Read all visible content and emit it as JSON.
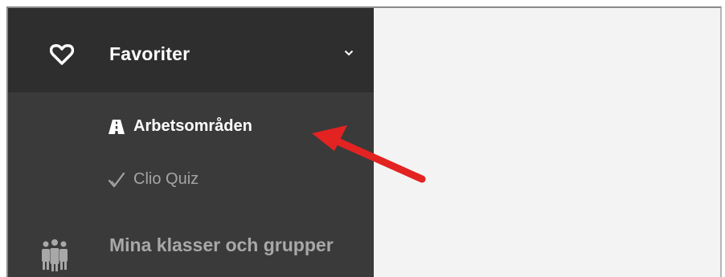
{
  "sidebar": {
    "favorites": {
      "label": "Favoriter",
      "icon": "heart-icon",
      "chevron": "chevron-down-icon",
      "items": [
        {
          "label": "Arbetsområden",
          "icon": "road-icon",
          "active": true
        },
        {
          "label": "Clio Quiz",
          "icon": "checkmark-icon",
          "active": false
        }
      ]
    },
    "classes": {
      "label": "Mina klasser och grupper",
      "icon": "group-icon"
    }
  },
  "colors": {
    "sidebar_bg": "#3a3a3a",
    "header_bg": "#2e2e2e",
    "content_bg": "#f3f3f3",
    "annotation_arrow": "#e32222"
  }
}
